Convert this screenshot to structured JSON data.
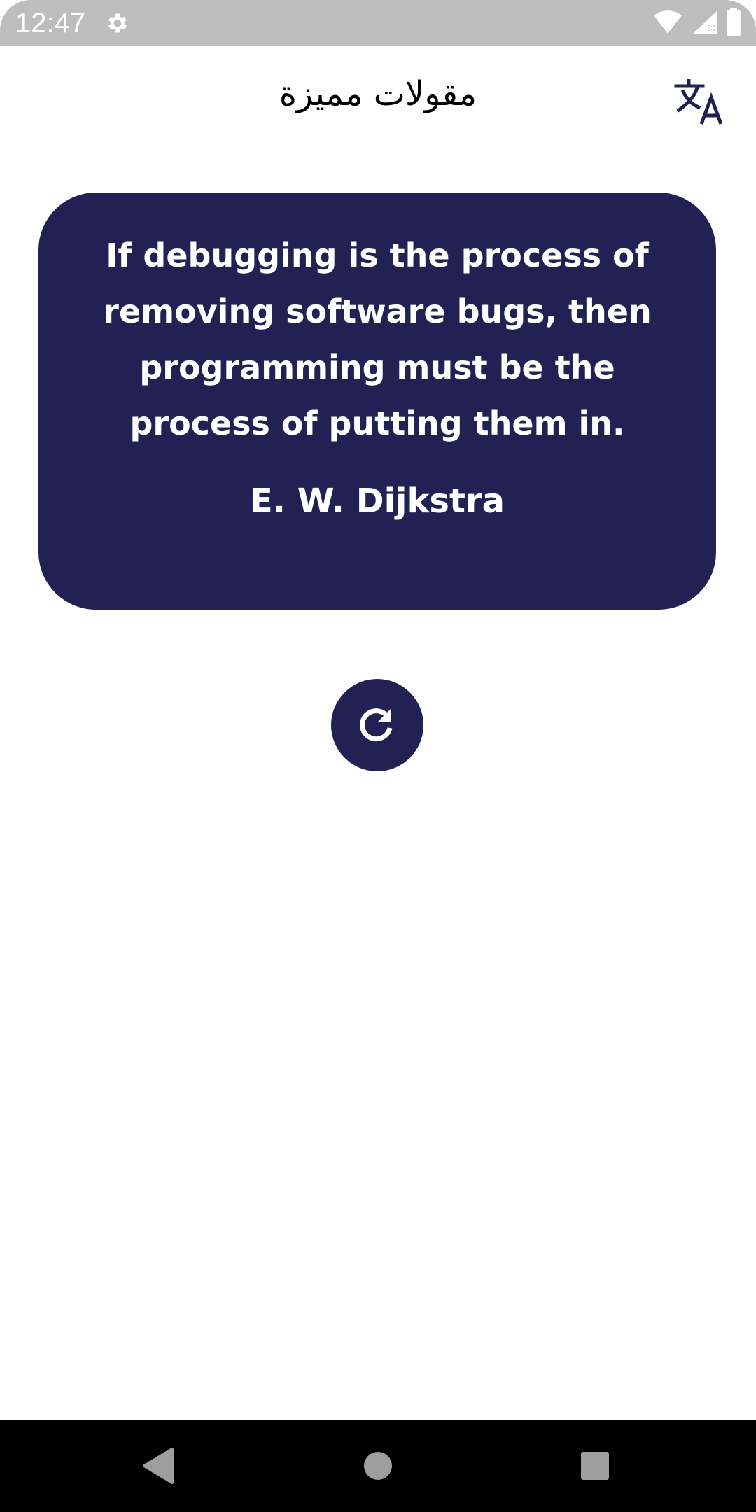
{
  "status_bar": {
    "time": "12:47",
    "icons": [
      "settings-icon",
      "wifi-icon",
      "signal-icon",
      "battery-icon"
    ]
  },
  "app_bar": {
    "title": "مقولات مميزة",
    "translate_icon": "translate-icon"
  },
  "quote": {
    "text": "If debugging is the process of removing software bugs, then programming must be the process of putting them in.",
    "author": "E. W. Dijkstra"
  },
  "actions": {
    "refresh_icon": "refresh-icon"
  },
  "navigation": {
    "back_icon": "back-icon",
    "home_icon": "home-icon",
    "recents_icon": "recents-icon"
  },
  "colors": {
    "primary": "#222154",
    "status_bar": "#bdbdbd",
    "nav_bar": "#000000",
    "background": "#ffffff"
  }
}
